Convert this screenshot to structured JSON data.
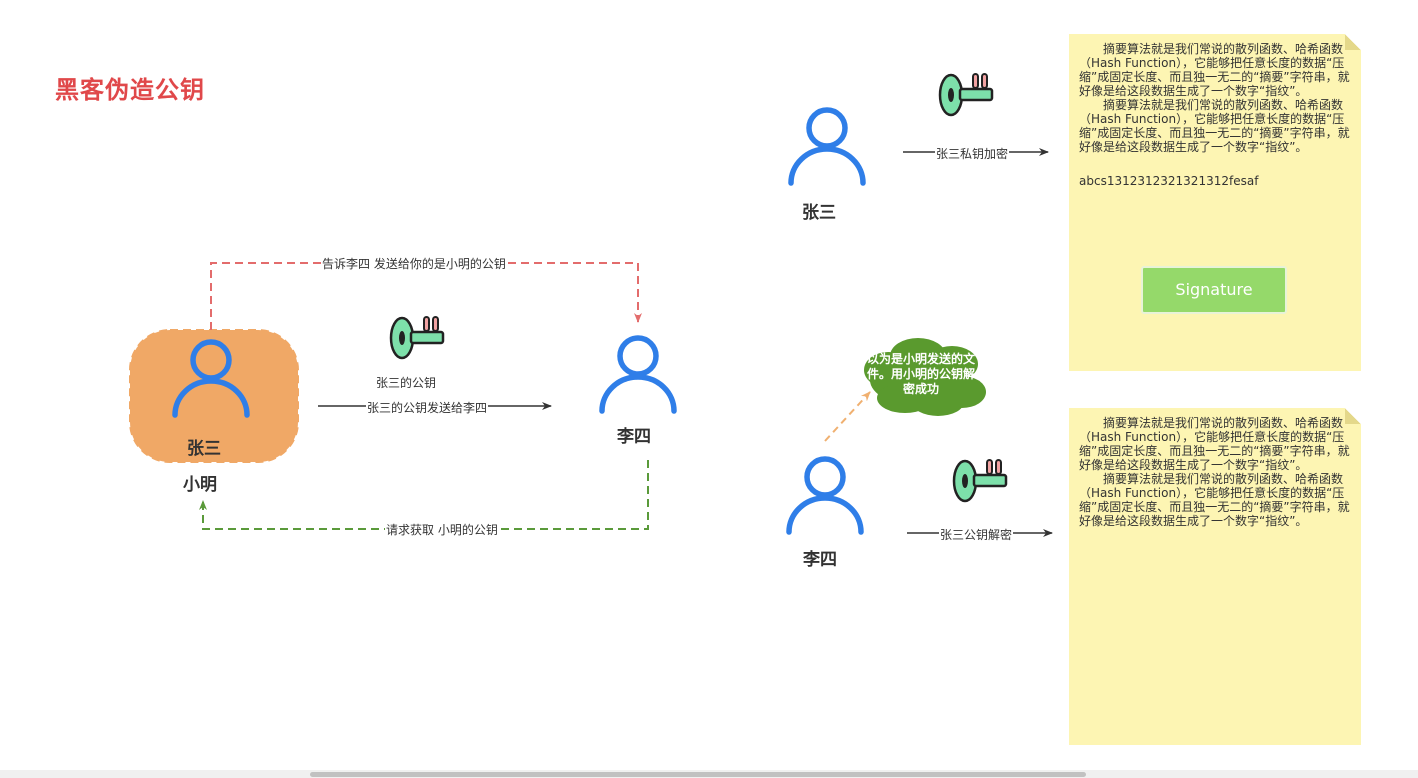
{
  "title": "黑客伪造公钥",
  "left": {
    "highlight_person": "张三",
    "highlight_caption": "小明",
    "receiver": "李四",
    "top_arrow_label": "告诉李四 发送给你的是小明的公钥",
    "key_caption": "张三的公钥",
    "send_arrow_label": "张三的公钥发送给李四",
    "bottom_arrow_label": "请求获取 小明的公钥"
  },
  "right_top": {
    "person": "张三",
    "arrow_label": "张三私钥加密",
    "note": {
      "paragraphs": [
        "摘要算法就是我们常说的散列函数、哈希函数（Hash Function），它能够把任意长度的数据“压缩”成固定长度、而且独一无二的“摘要”字符串，就好像是给这段数据生成了一个数字“指纹”。",
        "摘要算法就是我们常说的散列函数、哈希函数（Hash Function），它能够把任意长度的数据“压缩”成固定长度、而且独一无二的“摘要”字符串，就好像是给这段数据生成了一个数字“指纹”。"
      ],
      "hash": "abcs1312312321321312fesaf",
      "button": "Signature"
    }
  },
  "right_bottom": {
    "person": "李四",
    "arrow_label": "张三公钥解密",
    "cloud_text": "以为是小明发送的文件。用小明的公钥解密成功",
    "note": {
      "paragraphs": [
        "摘要算法就是我们常说的散列函数、哈希函数（Hash Function），它能够把任意长度的数据“压缩”成固定长度、而且独一无二的“摘要”字符串，就好像是给这段数据生成了一个数字“指纹”。",
        "摘要算法就是我们常说的散列函数、哈希函数（Hash Function），它能够把任意长度的数据“压缩”成固定长度、而且独一无二的“摘要”字符串，就好像是给这段数据生成了一个数字“指纹”。"
      ]
    }
  },
  "colors": {
    "person": "#2f7ee8",
    "highlight_bg": "#f0a866",
    "key_fill": "#7de0aa",
    "key_teeth": "#f2a3a3",
    "red_dashed": "#e36c6c",
    "green_dashed": "#5a9a3a",
    "orange_dashed": "#f0b070",
    "cloud": "#5a9a2e",
    "note_bg": "#fdf5b3",
    "button_bg": "#95d96a",
    "title": "#e0484a"
  },
  "icons": [
    "person-icon",
    "key-icon",
    "cloud-shape"
  ]
}
